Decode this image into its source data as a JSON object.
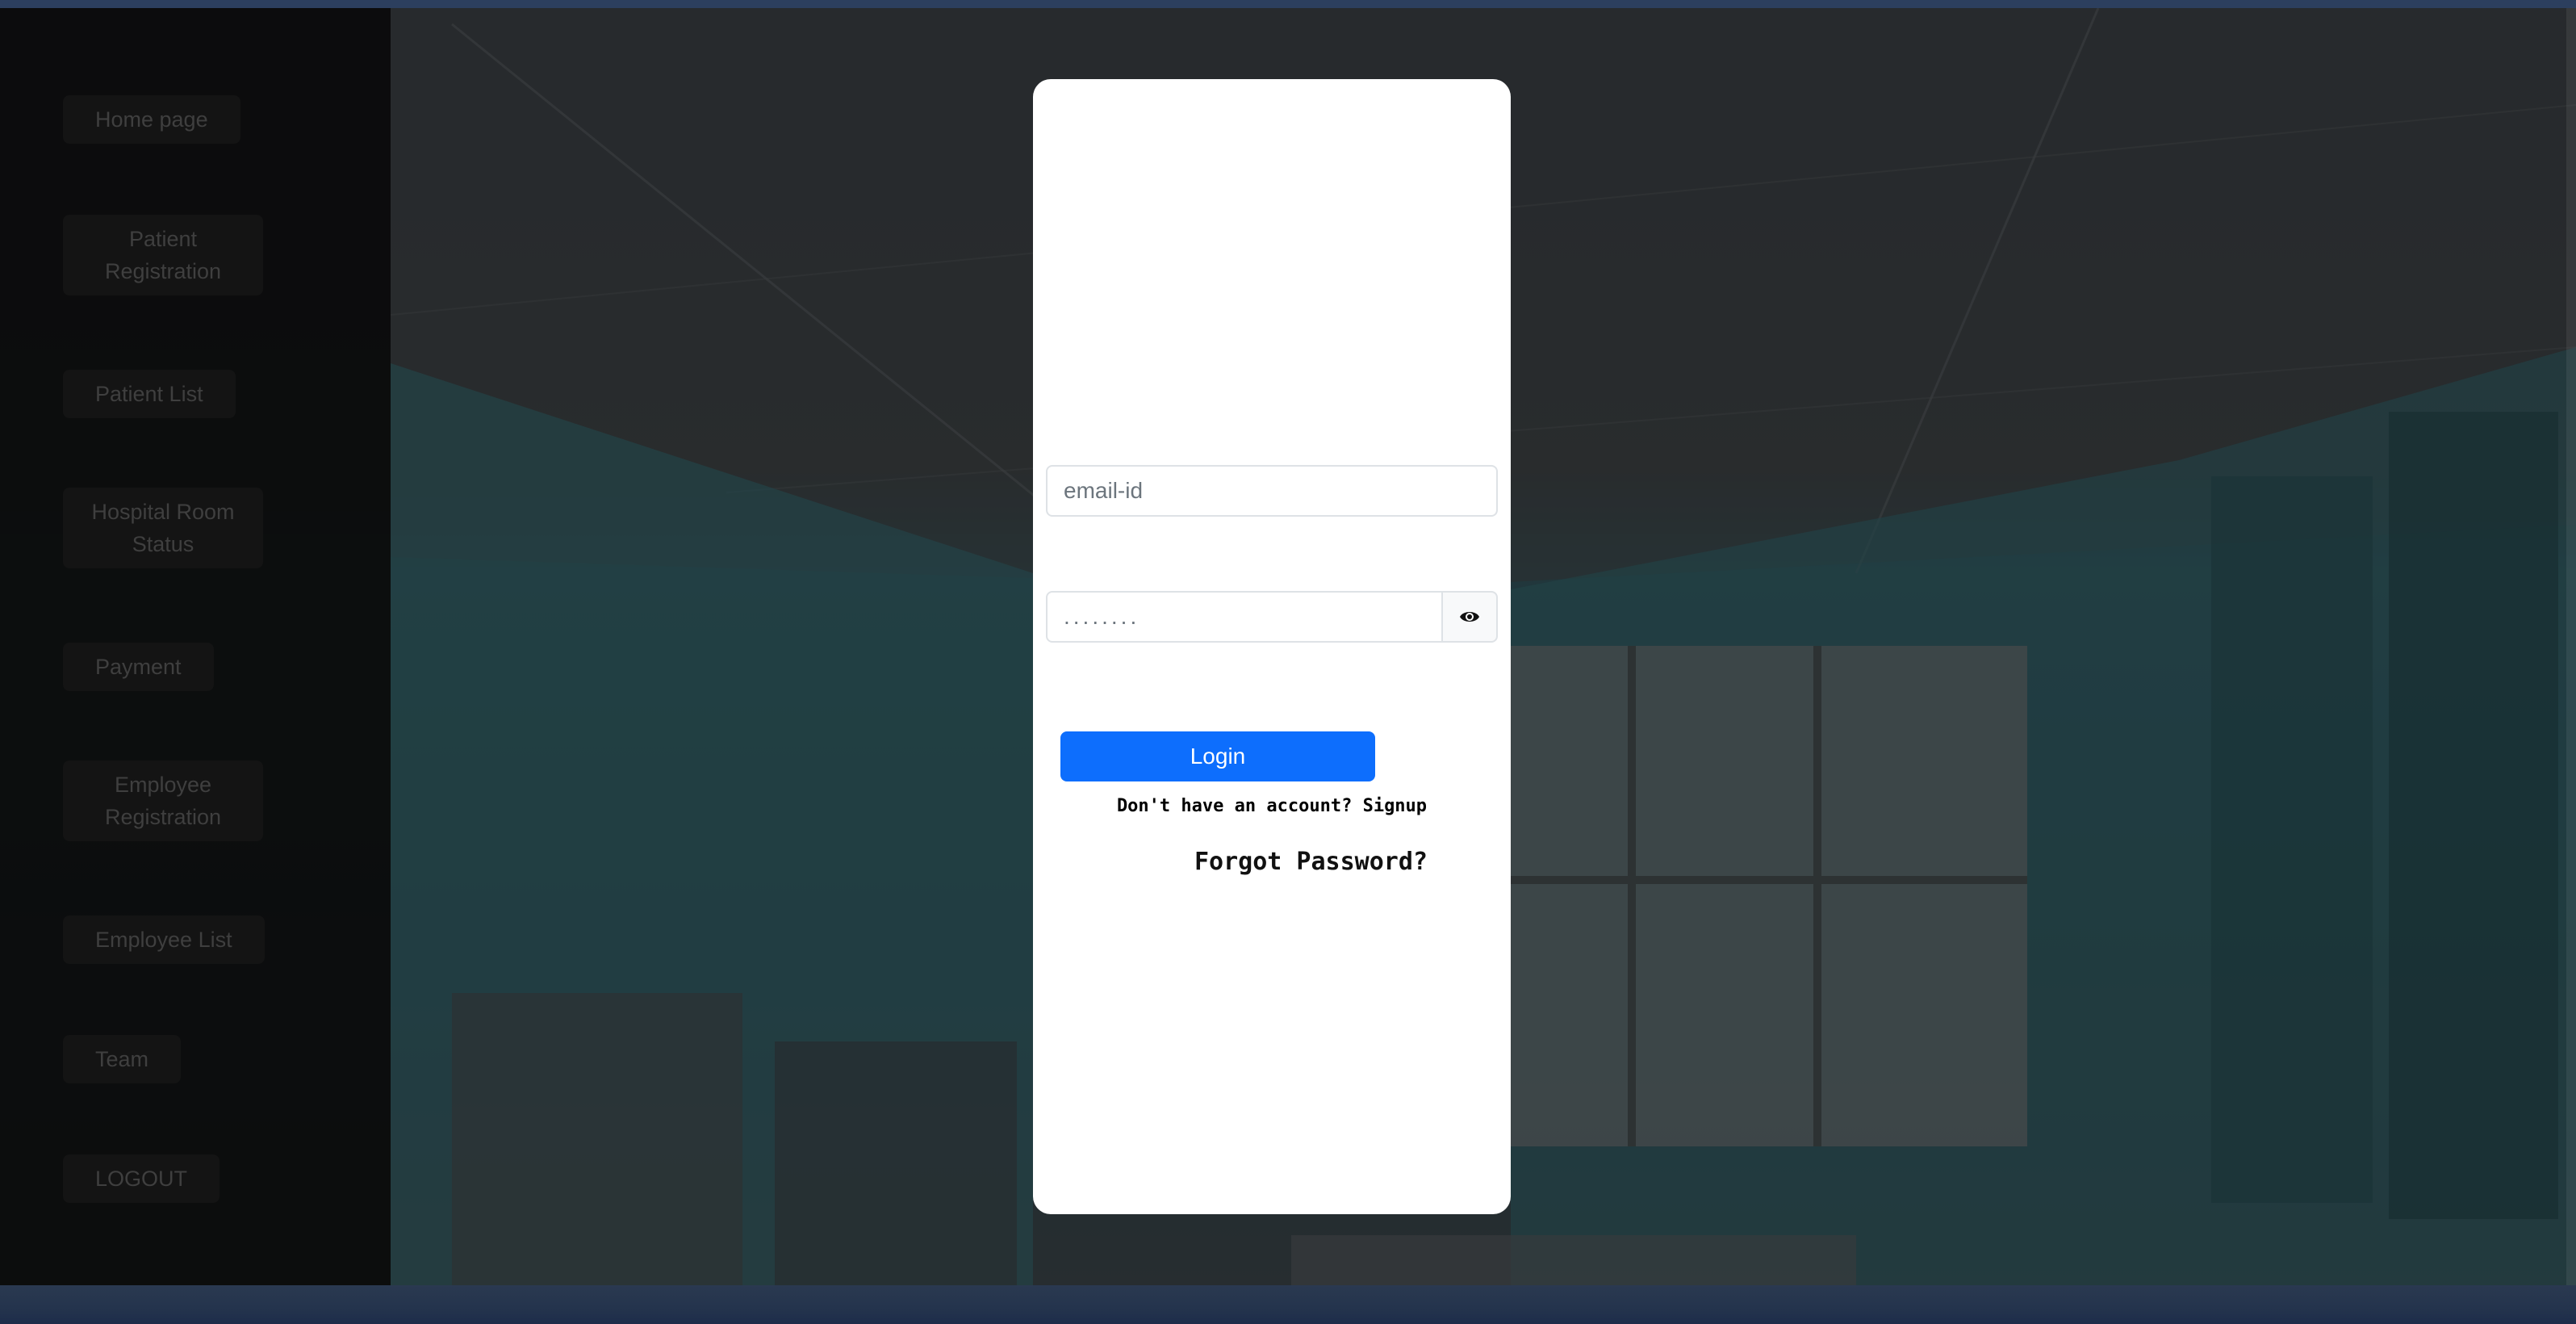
{
  "sidebar": {
    "items": [
      {
        "label": "Home page"
      },
      {
        "label": "Patient Registration"
      },
      {
        "label": "Patient List"
      },
      {
        "label": "Hospital Room Status"
      },
      {
        "label": "Payment"
      },
      {
        "label": "Employee Registration"
      },
      {
        "label": "Employee List"
      },
      {
        "label": "Team"
      },
      {
        "label": "LOGOUT"
      }
    ]
  },
  "login": {
    "email_placeholder": "email-id",
    "password_placeholder": "........",
    "login_label": "Login",
    "signup_prompt": "Don't have an account? Signup",
    "forgot_label": "Forgot Password?"
  },
  "colors": {
    "primary": "#0d6efd",
    "sidebar_bg": "#0a0a0a",
    "card_bg": "#ffffff"
  },
  "icons": {
    "password_toggle": "eye-icon"
  }
}
